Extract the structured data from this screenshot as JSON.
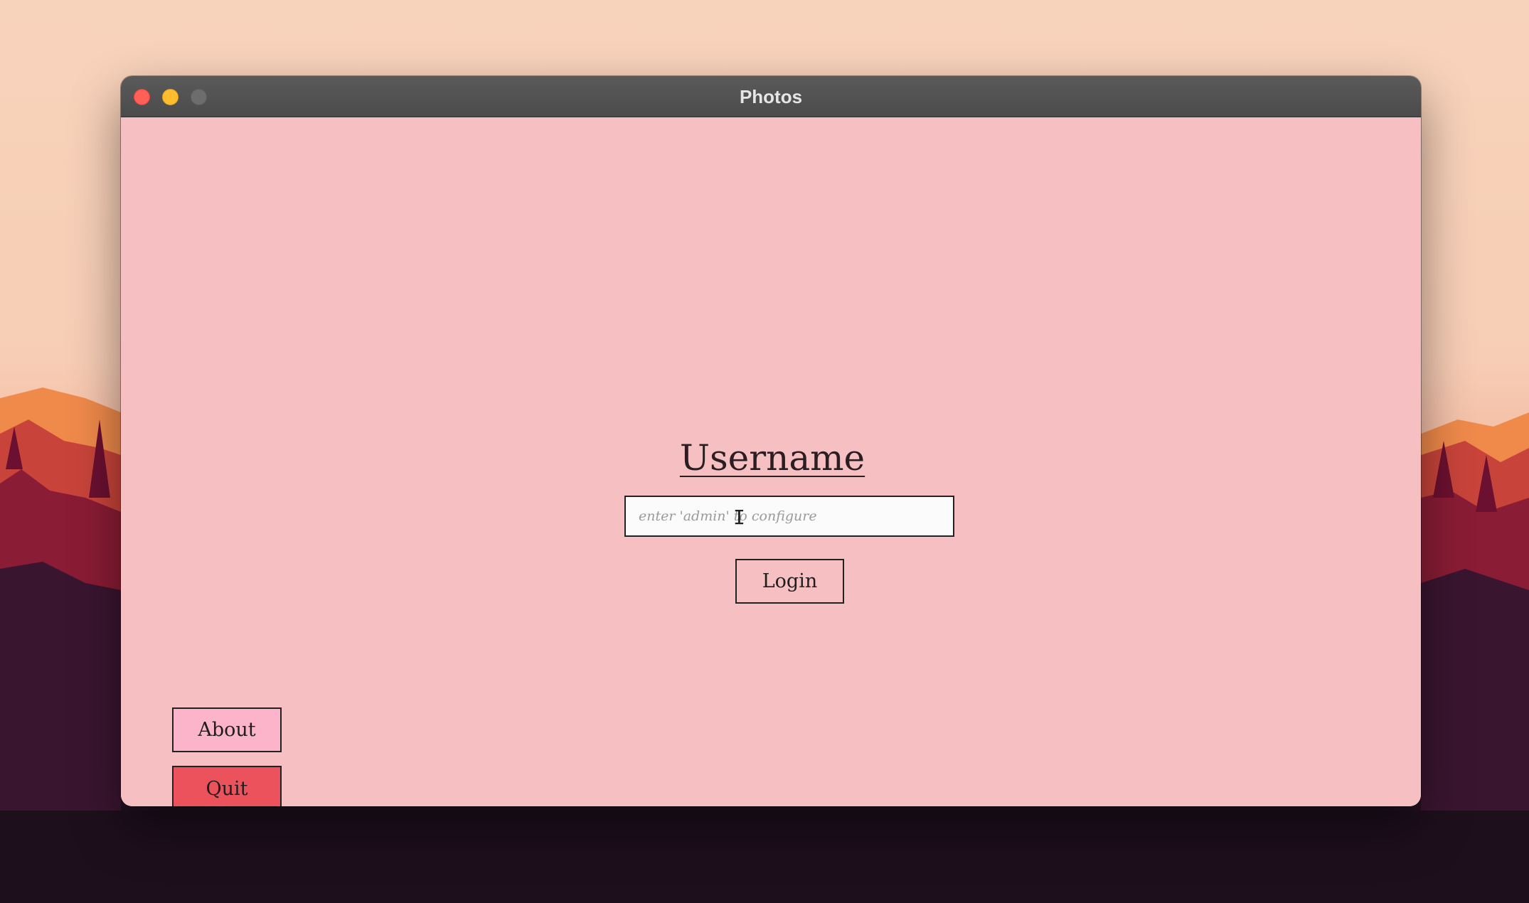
{
  "window": {
    "title": "Photos"
  },
  "login": {
    "heading": "Username",
    "input_placeholder": "enter 'admin' to configure",
    "input_value": "",
    "login_label": "Login"
  },
  "footer": {
    "about_label": "About",
    "quit_label": "Quit"
  },
  "theme": {
    "content_bg": "#f6c0c2",
    "about_bg": "#fbb4c9",
    "quit_bg": "#ec525c",
    "close_color": "#fe5f57",
    "minimize_color": "#febc2e",
    "zoom_color": "#6d6d6d"
  }
}
